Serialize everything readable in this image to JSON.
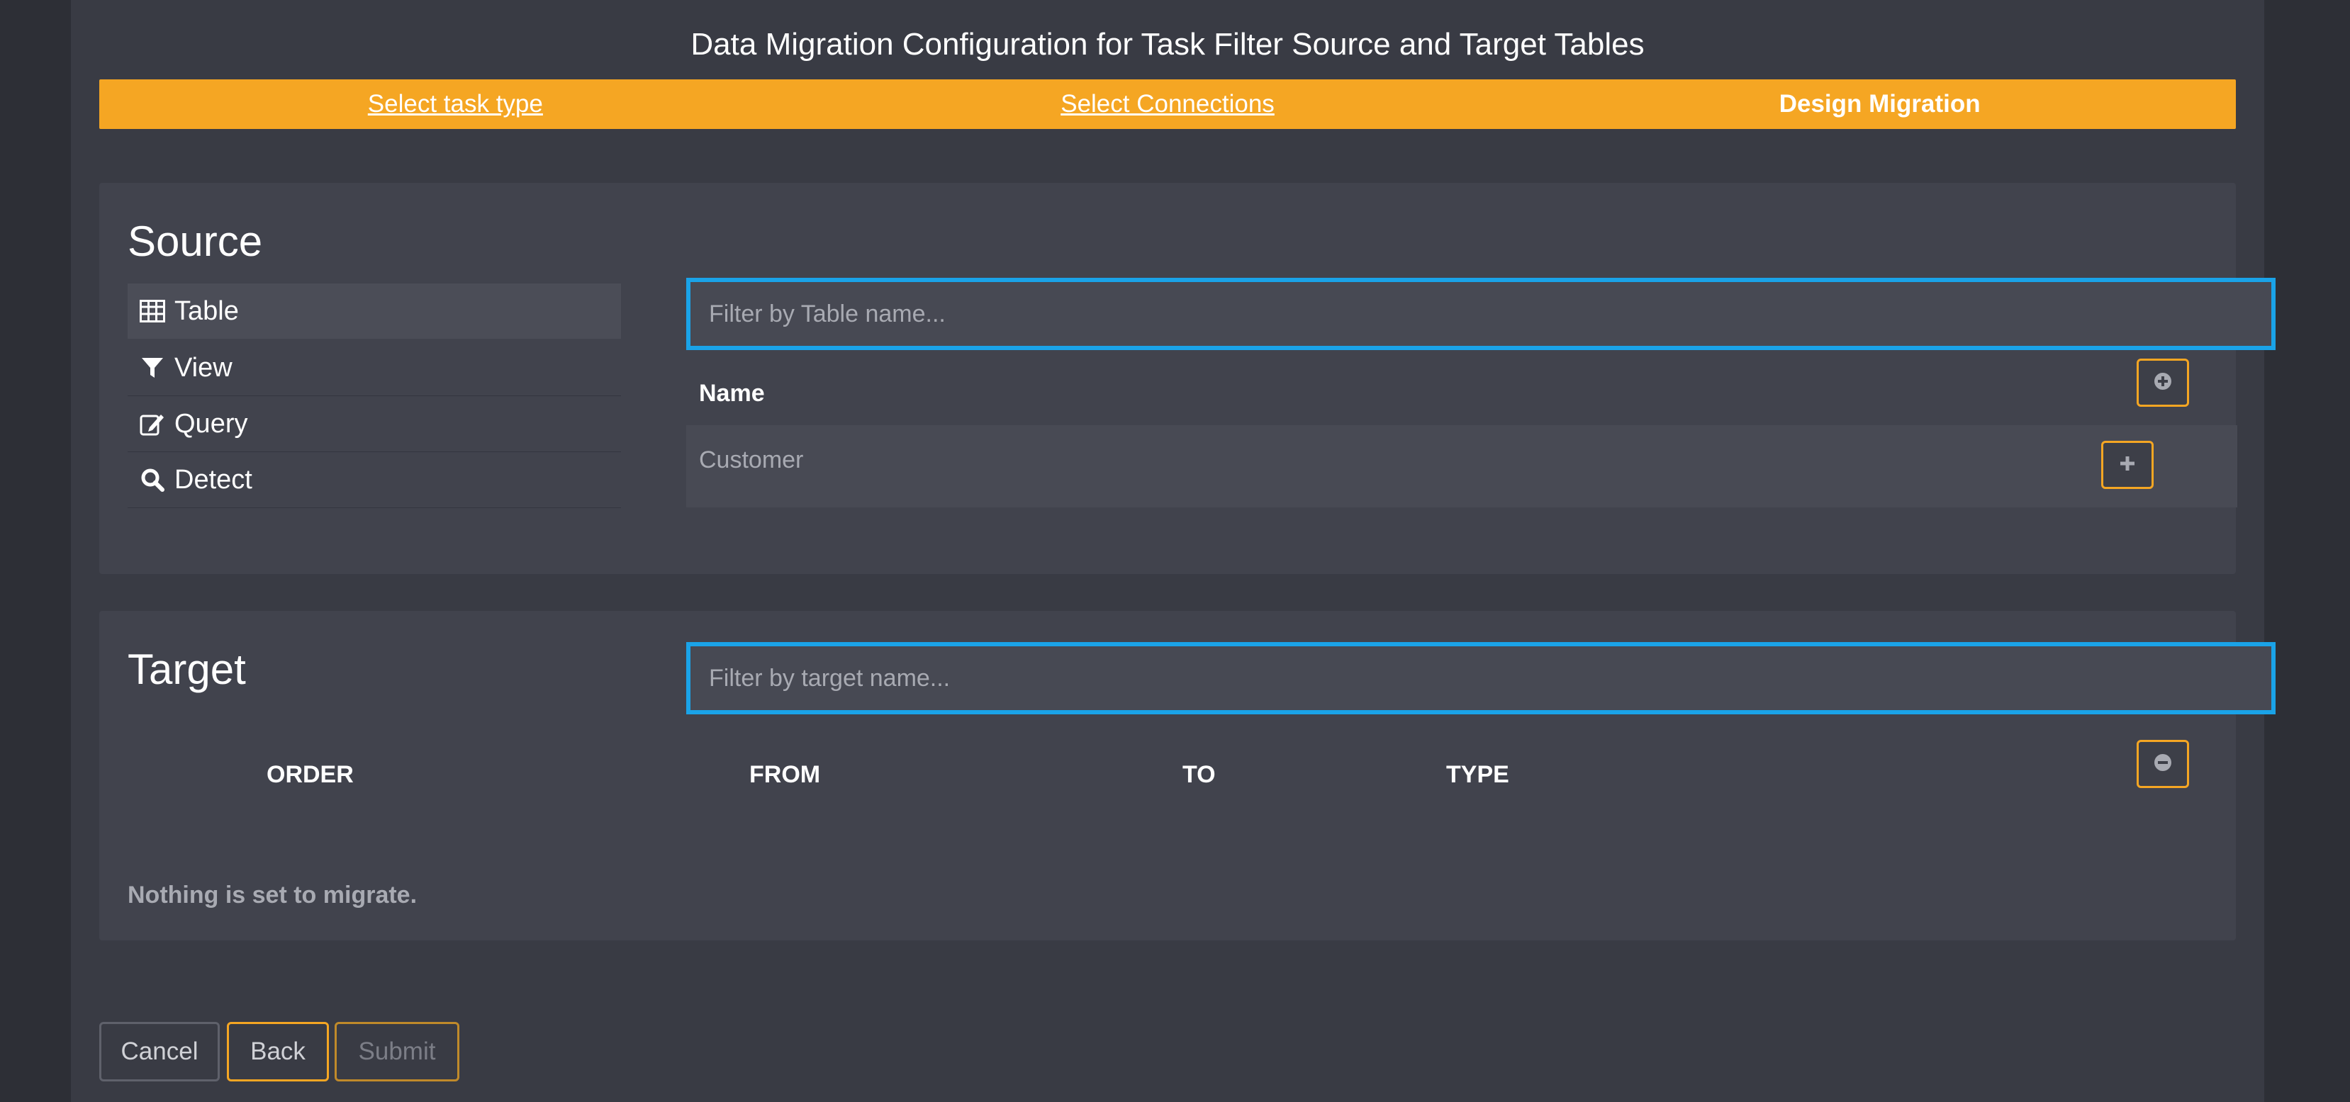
{
  "page": {
    "title": "Data Migration Configuration for Task Filter Source and Target Tables"
  },
  "steps": [
    {
      "label": "Select task type",
      "state": "link"
    },
    {
      "label": "Select Connections",
      "state": "link"
    },
    {
      "label": "Design Migration",
      "state": "current"
    }
  ],
  "source": {
    "heading": "Source",
    "types": [
      {
        "label": "Table",
        "icon": "table-icon",
        "active": true
      },
      {
        "label": "View",
        "icon": "filter-icon",
        "active": false
      },
      {
        "label": "Query",
        "icon": "edit-icon",
        "active": false
      },
      {
        "label": "Detect",
        "icon": "search-icon",
        "active": false
      }
    ],
    "filter_placeholder": "Filter by Table name...",
    "column_header": "Name",
    "rows": [
      {
        "name": "Customer"
      }
    ]
  },
  "target": {
    "heading": "Target",
    "filter_placeholder": "Filter by target name...",
    "columns": [
      "ORDER",
      "FROM",
      "TO",
      "TYPE"
    ],
    "empty_message": "Nothing is set to migrate."
  },
  "footer": {
    "cancel_label": "Cancel",
    "back_label": "Back",
    "submit_label": "Submit"
  },
  "colors": {
    "accent": "#f5a623",
    "focus": "#1aa3e8",
    "panel": "#41434d",
    "background": "#393b44"
  }
}
